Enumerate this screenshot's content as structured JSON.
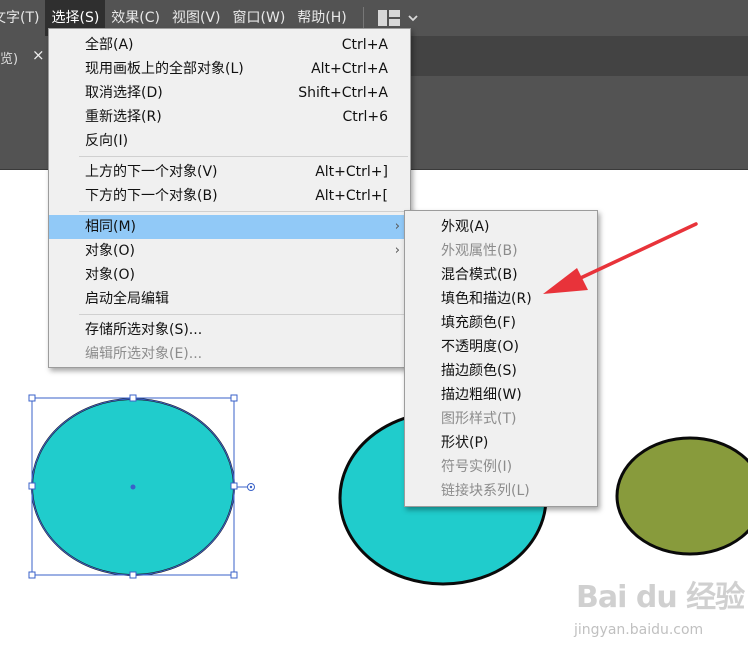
{
  "menubar": {
    "items": [
      "文字(T)",
      "选择(S)",
      "效果(C)",
      "视图(V)",
      "窗口(W)",
      "帮助(H)"
    ],
    "active_index": 1
  },
  "tabs": [
    {
      "label": "览)",
      "close": "×"
    }
  ],
  "select_menu": {
    "groups": [
      [
        {
          "label": "全部(A)",
          "shortcut": "Ctrl+A"
        },
        {
          "label": "现用画板上的全部对象(L)",
          "shortcut": "Alt+Ctrl+A"
        },
        {
          "label": "取消选择(D)",
          "shortcut": "Shift+Ctrl+A"
        },
        {
          "label": "重新选择(R)",
          "shortcut": "Ctrl+6"
        },
        {
          "label": "反向(I)",
          "shortcut": ""
        }
      ],
      [
        {
          "label": "上方的下一个对象(V)",
          "shortcut": "Alt+Ctrl+]"
        },
        {
          "label": "下方的下一个对象(B)",
          "shortcut": "Alt+Ctrl+["
        }
      ],
      [
        {
          "label": "相同(M)",
          "submenu": true,
          "highlighted": true
        },
        {
          "label": "对象(O)",
          "submenu": true
        },
        {
          "label": "对象(O)",
          "submenu": false
        },
        {
          "label": "启动全局编辑",
          "submenu": false
        }
      ],
      [
        {
          "label": "存储所选对象(S)...",
          "disabled": false
        },
        {
          "label": "编辑所选对象(E)...",
          "disabled": true
        }
      ]
    ]
  },
  "same_submenu": {
    "groups": [
      [
        {
          "label": "外观(A)",
          "disabled": false
        },
        {
          "label": "外观属性(B)",
          "disabled": true
        },
        {
          "label": "混合模式(B)",
          "disabled": false
        },
        {
          "label": "填色和描边(R)",
          "disabled": false
        },
        {
          "label": "填充颜色(F)",
          "disabled": false
        },
        {
          "label": "不透明度(O)",
          "disabled": false
        },
        {
          "label": "描边颜色(S)",
          "disabled": false
        },
        {
          "label": "描边粗细(W)",
          "disabled": false
        },
        {
          "label": "图形样式(T)",
          "disabled": true
        },
        {
          "label": "形状(P)",
          "disabled": false
        },
        {
          "label": "符号实例(I)",
          "disabled": true
        },
        {
          "label": "链接块系列(L)",
          "disabled": true
        }
      ]
    ]
  },
  "colors": {
    "ui_dark": "#535353",
    "menu_bg": "#f0f0f0",
    "menu_highlight": "#91c9f7",
    "cyan_fill": "#20cccc",
    "olive_fill": "#889b3c",
    "selection_blue": "#3a62c8",
    "annotation_red": "#e8333a"
  },
  "icons": {
    "workspace": "workspace-layout-icon",
    "workspace_dropdown": "chevron-down-icon",
    "submenu_arrow": "chevron-right-icon"
  },
  "watermark": {
    "logo": "Bai du 经验",
    "url": "jingyan.baidu.com"
  }
}
